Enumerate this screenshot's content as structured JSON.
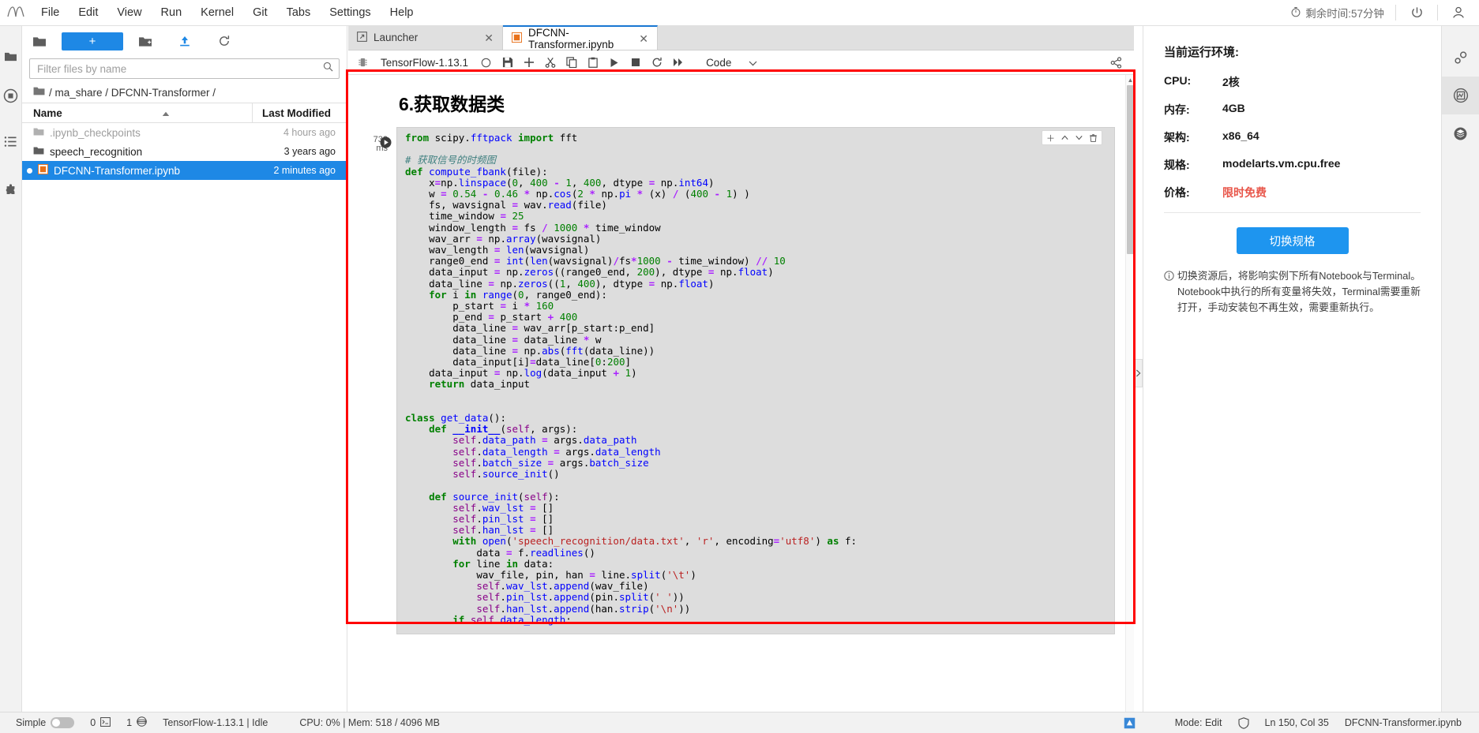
{
  "menubar": {
    "logo": "jupyter-logo",
    "items": [
      "File",
      "Edit",
      "View",
      "Run",
      "Kernel",
      "Git",
      "Tabs",
      "Settings",
      "Help"
    ],
    "time_left": "剩余时间:57分钟",
    "power_icon": "power-icon",
    "user_icon": "user-icon"
  },
  "left_rail": {
    "icons": [
      "folder-icon",
      "running-icon",
      "commands-icon",
      "extension-icon"
    ]
  },
  "filebrowser": {
    "toolbar": {
      "folder_icon": "folder-icon",
      "new_label": "+",
      "new_folder_icon": "new-folder-icon",
      "upload_icon": "upload-icon",
      "refresh_icon": "refresh-icon"
    },
    "search": {
      "placeholder": "Filter files by name",
      "value": "",
      "icon": "search-icon"
    },
    "breadcrumb": "/ ma_share / DFCNN-Transformer /",
    "columns": {
      "name": "Name",
      "modified": "Last Modified"
    },
    "rows": [
      {
        "name": ".ipynb_checkpoints",
        "modified": "4 hours ago",
        "type": "folder",
        "state": "dim"
      },
      {
        "name": "speech_recognition",
        "modified": "3 years ago",
        "type": "folder",
        "state": "normal"
      },
      {
        "name": "DFCNN-Transformer.ipynb",
        "modified": "2 minutes ago",
        "type": "notebook",
        "state": "selected"
      }
    ]
  },
  "notebook": {
    "tabs": [
      {
        "label": "Launcher",
        "icon": "launcher-icon",
        "active": false,
        "closable": true
      },
      {
        "label": "DFCNN-Transformer.ipynb",
        "icon": "notebook-icon",
        "active": true,
        "closable": true
      }
    ],
    "toolbar": {
      "kernel_icon": "kernel-icon",
      "kernel_name": "TensorFlow-1.13.1",
      "busy_icon": "kernel-idle-circle",
      "save_icon": "save-icon",
      "insert_icon": "add-cell-icon",
      "cut_icon": "cut-icon",
      "copy_icon": "copy-icon",
      "paste_icon": "paste-icon",
      "run_icon": "run-icon",
      "stop_icon": "stop-icon",
      "restart_icon": "restart-icon",
      "restart_run_all_icon": "fast-forward-icon",
      "cell_type": "Code",
      "chevron_icon": "chevron-down-icon",
      "share_icon": "share-icon"
    },
    "title": "6.获取数据类",
    "cell": {
      "prompt_time": "738",
      "prompt_unit": "ms",
      "run_icon": "run-cell-icon",
      "cell_toolbar_icons": [
        "add-icon",
        "move-up-icon",
        "move-down-icon",
        "delete-icon"
      ],
      "code_lines": [
        "from scipy.fftpack import fft",
        "",
        "# 获取信号的时频图",
        "def compute_fbank(file):",
        "    x=np.linspace(0, 400 - 1, 400, dtype = np.int64)",
        "    w = 0.54 - 0.46 * np.cos(2 * np.pi * (x) / (400 - 1) )",
        "    fs, wavsignal = wav.read(file)",
        "    time_window = 25",
        "    window_length = fs / 1000 * time_window",
        "    wav_arr = np.array(wavsignal)",
        "    wav_length = len(wavsignal)",
        "    range0_end = int(len(wavsignal)/fs*1000 - time_window) // 10",
        "    data_input = np.zeros((range0_end, 200), dtype = np.float)",
        "    data_line = np.zeros((1, 400), dtype = np.float)",
        "    for i in range(0, range0_end):",
        "        p_start = i * 160",
        "        p_end = p_start + 400",
        "        data_line = wav_arr[p_start:p_end]",
        "        data_line = data_line * w",
        "        data_line = np.abs(fft(data_line))",
        "        data_input[i]=data_line[0:200]",
        "    data_input = np.log(data_input + 1)",
        "    return data_input",
        "",
        "",
        "class get_data():",
        "    def __init__(self, args):",
        "        self.data_path = args.data_path",
        "        self.data_length = args.data_length",
        "        self.batch_size = args.batch_size",
        "        self.source_init()",
        "",
        "    def source_init(self):",
        "        self.wav_lst = []",
        "        self.pin_lst = []",
        "        self.han_lst = []",
        "        with open('speech_recognition/data.txt', 'r', encoding='utf8') as f:",
        "            data = f.readlines()",
        "        for line in data:",
        "            wav_file, pin, han = line.split('\\t')",
        "            self.wav_lst.append(wav_file)",
        "            self.pin_lst.append(pin.split(' '))",
        "            self.han_lst.append(han.strip('\\n'))",
        "        if self.data_length:"
      ]
    }
  },
  "right_panel": {
    "title": "当前运行环境:",
    "rows": [
      {
        "key": "CPU:",
        "value": "2核",
        "accent": false
      },
      {
        "key": "内存:",
        "value": "4GB",
        "accent": false
      },
      {
        "key": "架构:",
        "value": "x86_64",
        "accent": false
      },
      {
        "key": "规格:",
        "value": "modelarts.vm.cpu.free",
        "accent": false
      },
      {
        "key": "价格:",
        "value": "限时免费",
        "accent": true
      }
    ],
    "button": "切换规格",
    "note_icon": "info-icon",
    "note": "切换资源后，将影响实例下所有Notebook与Terminal。Notebook中执行的所有变量将失效，Terminal需要重新打开，手动安装包不再生效，需要重新执行。",
    "accent_color": "#e8564a",
    "button_color": "#1e95ef"
  },
  "right_rail": {
    "icons": [
      "property-inspector-icon",
      "variable-inspector-icon",
      "layers-icon"
    ]
  },
  "statusbar": {
    "mode_simple_label": "Simple",
    "toggle_state": "off",
    "terminals_icon": "terminal-icon",
    "terminals_count": "0",
    "kernels_icon": "kernel-count-icon",
    "kernels_count": "1",
    "globe_icon": "globe-icon",
    "kernel_status": "TensorFlow-1.13.1 | Idle",
    "resources": "CPU: 0% | Mem: 518 / 4096 MB",
    "mode": "Mode: Edit",
    "shield_icon": "shield-icon",
    "cursor": "Ln 150, Col 35",
    "filename": "DFCNN-Transformer.ipynb",
    "notification_icon": "notification-icon"
  }
}
